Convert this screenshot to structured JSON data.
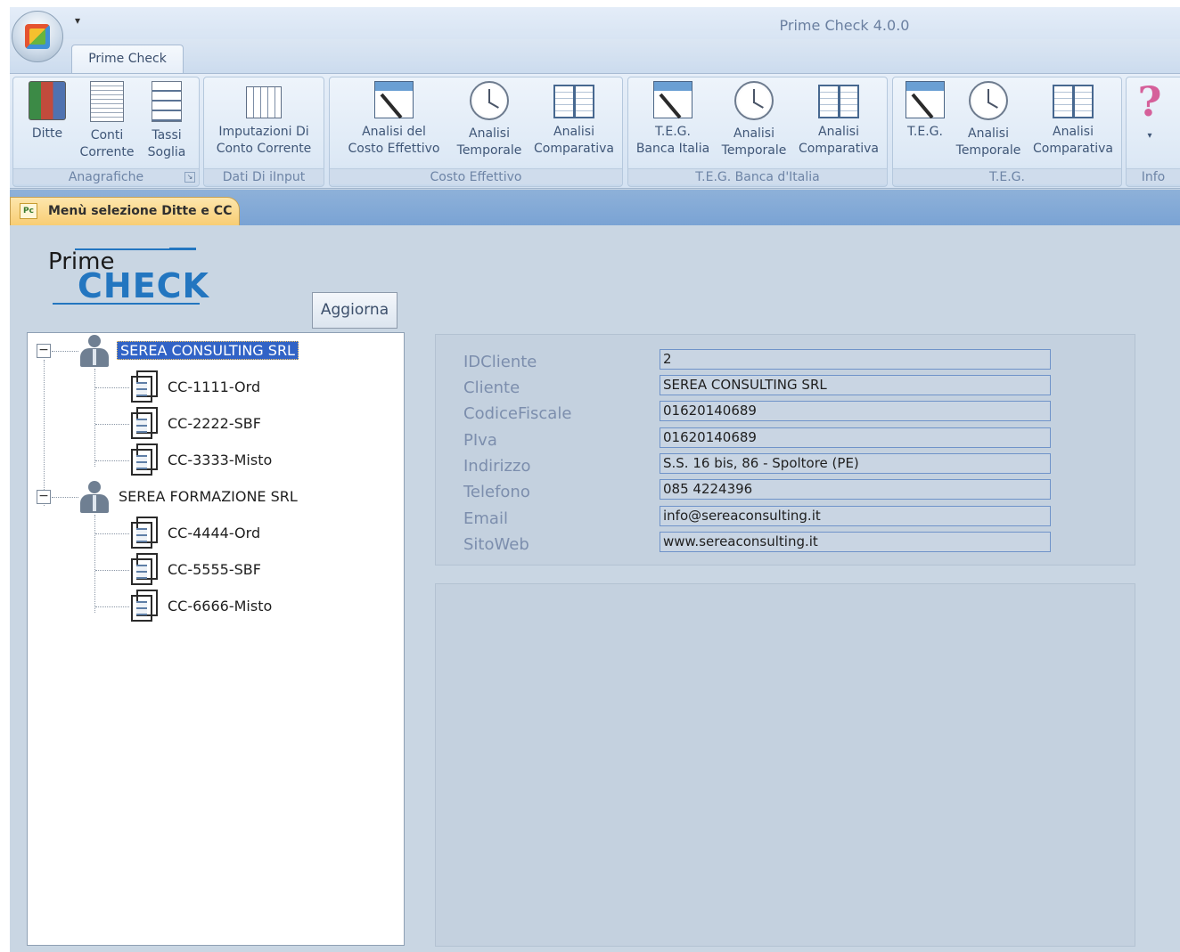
{
  "window": {
    "title": "Prime Check 4.0.0",
    "qat_glyph": "▾"
  },
  "ribbon": {
    "tab": "Prime Check",
    "groups": [
      {
        "label": "Anagrafiche",
        "buttons": [
          {
            "line1": "Ditte",
            "line2": ""
          },
          {
            "line1": "Conti",
            "line2": "Corrente"
          },
          {
            "line1": "Tassi",
            "line2": "Soglia"
          }
        ]
      },
      {
        "label": "Dati Di iInput",
        "buttons": [
          {
            "line1": "Imputazioni Di",
            "line2": "Conto Corrente"
          }
        ]
      },
      {
        "label": "Costo Effettivo",
        "buttons": [
          {
            "line1": "Analisi del",
            "line2": "Costo   Effettivo"
          },
          {
            "line1": "Analisi",
            "line2": "Temporale"
          },
          {
            "line1": "Analisi",
            "line2": "Comparativa"
          }
        ]
      },
      {
        "label": "T.E.G. Banca d'Italia",
        "buttons": [
          {
            "line1": "T.E.G.",
            "line2": "Banca Italia"
          },
          {
            "line1": "Analisi",
            "line2": "Temporale"
          },
          {
            "line1": "Analisi",
            "line2": "Comparativa"
          }
        ]
      },
      {
        "label": "T.E.G.",
        "buttons": [
          {
            "line1": "T.E.G.",
            "line2": ""
          },
          {
            "line1": "Analisi",
            "line2": "Temporale"
          },
          {
            "line1": "Analisi",
            "line2": "Comparativa"
          }
        ]
      },
      {
        "label": "Info",
        "buttons": [
          {
            "line1": "▾",
            "line2": ""
          }
        ]
      }
    ]
  },
  "document_tab": {
    "label": "Menù selezione Ditte e CC",
    "icon_text": "Pc"
  },
  "logo": {
    "prime": "Prime",
    "check": "CHECK"
  },
  "refresh_button": "Aggiorna",
  "tree": {
    "companies": [
      {
        "name": "SEREA CONSULTING SRL",
        "selected": true,
        "accounts": [
          "CC-1111-Ord",
          "CC-2222-SBF",
          "CC-3333-Misto"
        ]
      },
      {
        "name": "SEREA FORMAZIONE SRL",
        "selected": false,
        "accounts": [
          "CC-4444-Ord",
          "CC-5555-SBF",
          "CC-6666-Misto"
        ]
      }
    ],
    "expander_glyph": "−"
  },
  "details": {
    "fields": [
      {
        "label": "IDCliente",
        "value": "2"
      },
      {
        "label": "Cliente",
        "value": "SEREA CONSULTING SRL"
      },
      {
        "label": "CodiceFiscale",
        "value": "01620140689"
      },
      {
        "label": "PIva",
        "value": "01620140689"
      },
      {
        "label": "Indirizzo",
        "value": "S.S. 16 bis, 86 -  Spoltore (PE)"
      },
      {
        "label": "Telefono",
        "value": "085 4224396"
      },
      {
        "label": "Email",
        "value": "info@sereaconsulting.it"
      },
      {
        "label": "SitoWeb",
        "value": "www.sereaconsulting.it"
      }
    ]
  },
  "colors": {
    "selection": "#3163c6",
    "logo_blue": "#2376c0",
    "panel_bg": "#c9d6e3"
  }
}
